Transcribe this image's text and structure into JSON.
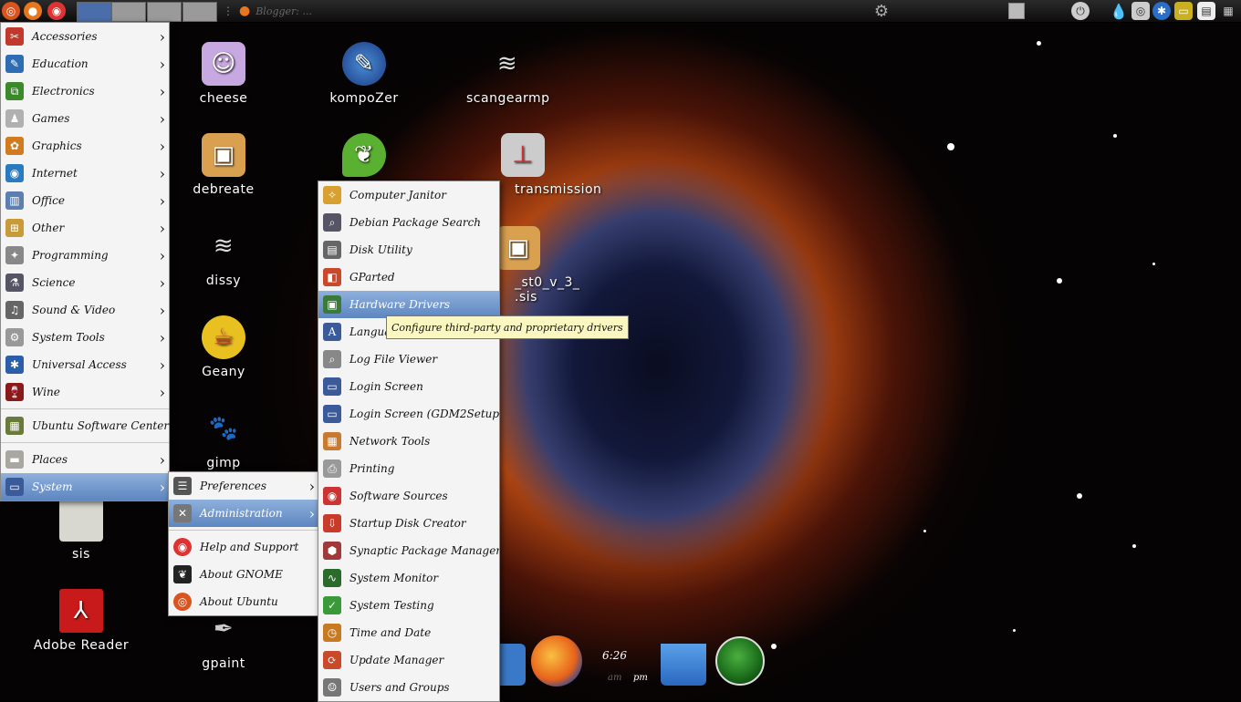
{
  "top_panel": {
    "task_title": "Blogger: ...",
    "workspaces": [
      "1",
      "2",
      "3",
      "4"
    ]
  },
  "desktop_icons": [
    {
      "label": "cheese",
      "icon": "cheese-icon"
    },
    {
      "label": "kompoZer",
      "icon": "kompozer-icon"
    },
    {
      "label": "scangearmp",
      "icon": "scanner-icon"
    },
    {
      "label": "debreate",
      "icon": "package-icon"
    },
    {
      "label": "transmission",
      "icon": "transmission-icon"
    },
    {
      "label": "dissy",
      "icon": "dissy-icon"
    },
    {
      "label": "Geany",
      "icon": "geany-icon"
    },
    {
      "label": "gimp",
      "icon": "gimp-icon"
    },
    {
      "label": "sis",
      "icon": "folder-icon"
    },
    {
      "label": "Adobe Reader",
      "icon": "pdf-icon"
    },
    {
      "label": "gpaint",
      "icon": "brush-icon"
    },
    {
      "label": "_st0_v_3_",
      "icon": "package-icon"
    },
    {
      "label": ".sis",
      "icon": ""
    }
  ],
  "applications_menu": [
    {
      "label": "Accessories",
      "color": "#c0392b"
    },
    {
      "label": "Education",
      "color": "#2e6db4"
    },
    {
      "label": "Electronics",
      "color": "#3a8a2a"
    },
    {
      "label": "Games",
      "color": "#b0b0b0"
    },
    {
      "label": "Graphics",
      "color": "#d07b20"
    },
    {
      "label": "Internet",
      "color": "#2a7ac0"
    },
    {
      "label": "Office",
      "color": "#5a7fb0"
    },
    {
      "label": "Other",
      "color": "#c89a3a"
    },
    {
      "label": "Programming",
      "color": "#888"
    },
    {
      "label": "Science",
      "color": "#556"
    },
    {
      "label": "Sound & Video",
      "color": "#666"
    },
    {
      "label": "System Tools",
      "color": "#999"
    },
    {
      "label": "Universal Access",
      "color": "#2a5ea8"
    },
    {
      "label": "Wine",
      "color": "#8a1a1a"
    }
  ],
  "software_center": "Ubuntu Software Center",
  "places": "Places",
  "system": "System",
  "system_menu": {
    "preferences": "Preferences",
    "administration": "Administration",
    "help": "Help and Support",
    "about_gnome": "About GNOME",
    "about_ubuntu": "About Ubuntu"
  },
  "admin_menu": [
    "Computer Janitor",
    "Debian Package Search",
    "Disk Utility",
    "GParted",
    "Hardware Drivers",
    "Language Support",
    "Log File Viewer",
    "Login Screen",
    "Login Screen (GDM2Setup)",
    "Network Tools",
    "Printing",
    "Software Sources",
    "Startup Disk Creator",
    "Synaptic Package Manager",
    "System Monitor",
    "System Testing",
    "Time and Date",
    "Update Manager",
    "Users and Groups"
  ],
  "admin_highlighted": "Hardware Drivers",
  "tooltip": "Configure third-party and proprietary drivers",
  "clock": {
    "time": "6:26",
    "am": "am",
    "pm": "pm"
  }
}
